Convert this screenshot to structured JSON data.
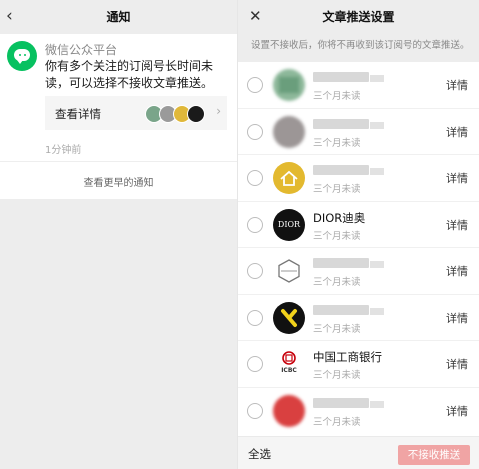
{
  "left": {
    "nav": {
      "back_glyph": "‹",
      "title": "通知"
    },
    "card": {
      "sender": "微信公众平台",
      "message": "你有多个关注的订阅号长时间未读，可以选择不接收文章推送。",
      "detail_label": "查看详情",
      "detail_chevron": "›",
      "mini_avatars": [
        {
          "color": "#7aa58a",
          "label": ""
        },
        {
          "color": "#9a9a9a",
          "label": ""
        },
        {
          "color": "#e0b83a",
          "label": ""
        },
        {
          "color": "#1a1a1a",
          "label": ""
        }
      ],
      "time": "1分钟前",
      "earlier": "查看更早的通知"
    }
  },
  "right": {
    "nav": {
      "close_glyph": "✕",
      "title": "文章推送设置"
    },
    "notice": "设置不接收后，你将不再收到该订阅号的文章推送。",
    "rows": [
      {
        "name": "",
        "sub": "三个月未读",
        "detail": "详情",
        "avatar_color": "#8db89a",
        "avatar_icon": "blur"
      },
      {
        "name": "",
        "sub": "三个月未读",
        "detail": "详情",
        "avatar_color": "#9c9696",
        "avatar_icon": "blur"
      },
      {
        "name": "",
        "sub": "三个月未读",
        "detail": "详情",
        "avatar_color": "#e3b92f",
        "avatar_icon": "house-icon"
      },
      {
        "name": "DIOR迪奥",
        "sub": "三个月未读",
        "detail": "详情",
        "avatar_color": "#111111",
        "avatar_icon": "dior-logo",
        "avatar_text": "DIOR"
      },
      {
        "name": "",
        "sub": "三个月未读",
        "detail": "详情",
        "avatar_color": "#ffffff",
        "avatar_icon": "hex-logo"
      },
      {
        "name": "",
        "sub": "三个月未读",
        "detail": "详情",
        "avatar_color": "#111111",
        "avatar_icon": "yellow-x-logo"
      },
      {
        "name": "中国工商银行",
        "sub": "三个月未读",
        "detail": "详情",
        "avatar_color": "#ffffff",
        "avatar_icon": "icbc-logo",
        "avatar_text": "ICBC"
      },
      {
        "name": "",
        "sub": "三个月未读",
        "detail": "详情",
        "avatar_color": "#d94040",
        "avatar_icon": "blur"
      }
    ],
    "bottom": {
      "select_all": "全选",
      "reject_button": "不接收推送"
    }
  },
  "colors": {
    "wechat_green": "#07c160",
    "reject_button": "#f0a4a4"
  }
}
